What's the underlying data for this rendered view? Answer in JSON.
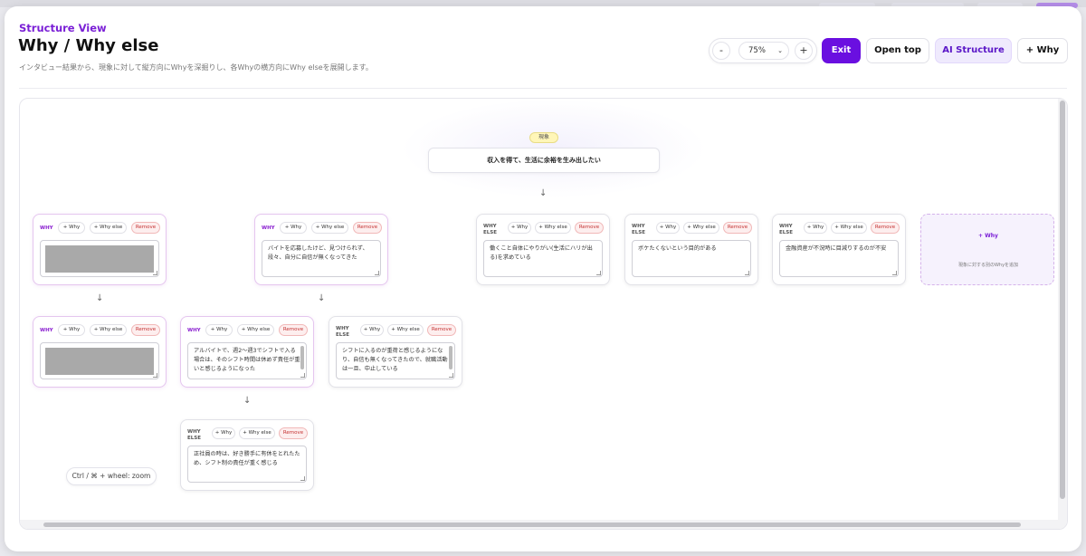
{
  "header": {
    "eyebrow": "Structure View",
    "title": "Why / Why else",
    "description": "インタビュー結果から、現象に対して縦方向にWhyを深掘りし、各Whyの横方向にWhy elseを展開します。"
  },
  "toolbar": {
    "zoom_out": "-",
    "zoom_value": "75%",
    "zoom_in": "+",
    "exit": "Exit",
    "open_top": "Open top",
    "ai_structure": "AI Structure",
    "add_why": "+ Why"
  },
  "phenomenon": {
    "badge": "現象",
    "text": "収入を得て、生活に余裕を生み出したい"
  },
  "card_labels": {
    "why": "WHY",
    "why_else": "WHY ELSE",
    "add_why": "+ Why",
    "add_why_else": "+ Why else",
    "remove": "Remove"
  },
  "cards": [
    {
      "kind": "why",
      "text": ""
    },
    {
      "kind": "why",
      "text": "バイトを応募したけど、見つけられず、段々、自分に自信が無くなってきた"
    },
    {
      "kind": "why_else",
      "text": "働くこと自体にやりがい(生活にハリが出る)を求めている"
    },
    {
      "kind": "why_else",
      "text": "ボケたくないという目的がある"
    },
    {
      "kind": "why_else",
      "text": "金融資産が不況時に目減りするのが不安"
    },
    {
      "kind": "why",
      "text": ""
    },
    {
      "kind": "why",
      "text": "アルバイトで、週2〜週3でシフトで入る場合は、そのシフト時間は休めず責任が重いと感じるようになった"
    },
    {
      "kind": "why_else",
      "text": "シフトに入るのが重荷と感じるようになり、自信も無くなってきたので、就職活動は一旦、中止している"
    },
    {
      "kind": "why_else",
      "text": "正社員の時は、好き勝手に有休をとれたため、シフト制の責任が重く感じる"
    }
  ],
  "add_card": {
    "title": "+ Why",
    "subtitle": "現象に対する別のWhyを追加"
  },
  "hint": "Ctrl / ⌘ + wheel: zoom",
  "arrow": "↓",
  "colors": {
    "accent": "#6a0fe0",
    "why_label": "#8a1fd0",
    "remove": "#c53333",
    "badge": "#fff6b8"
  }
}
